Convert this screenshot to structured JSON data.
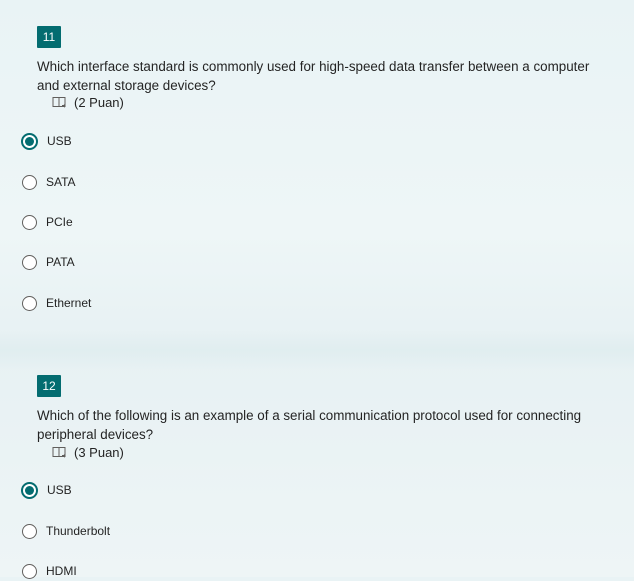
{
  "questions": [
    {
      "number": "11",
      "text_line1": "Which interface standard is commonly used for high-speed data transfer between a computer",
      "text_line2": "and external storage devices?",
      "points": "(2 Puan)",
      "options": [
        {
          "label": "USB",
          "selected": true
        },
        {
          "label": "SATA",
          "selected": false
        },
        {
          "label": "PCIe",
          "selected": false
        },
        {
          "label": "PATA",
          "selected": false
        },
        {
          "label": "Ethernet",
          "selected": false
        }
      ]
    },
    {
      "number": "12",
      "text_line1": "Which of the following is an example of a serial communication protocol used for connecting",
      "text_line2": "peripheral devices?",
      "points": "(3 Puan)",
      "options": [
        {
          "label": "USB",
          "selected": true
        },
        {
          "label": "Thunderbolt",
          "selected": false
        },
        {
          "label": "HDMI",
          "selected": false
        }
      ]
    }
  ],
  "icons": {
    "points_icon": "immersive-reader-icon"
  },
  "colors": {
    "accent": "#036c70"
  }
}
